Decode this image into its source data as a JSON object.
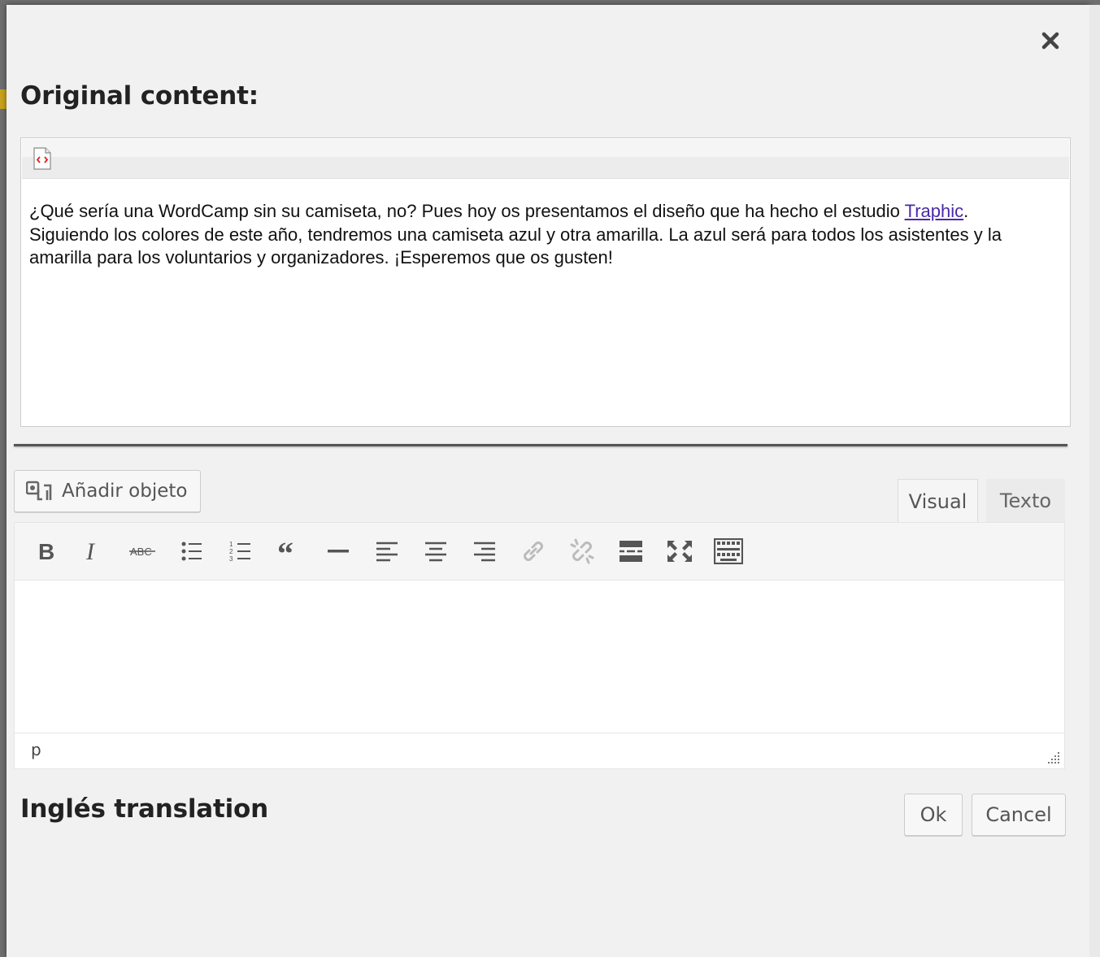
{
  "dialog": {
    "original_title": "Original content:",
    "original_text_before_link": "¿Qué sería una WordCamp sin su camiseta, no? Pues hoy os presentamos el diseño que ha hecho el estudio ",
    "original_link_text": "Traphic",
    "original_text_after_link": ". Siguiendo los colores de este año, tendremos una camiseta azul y otra amarilla. La azul será para todos los asistentes y la amarilla para los voluntarios y organizadores. ¡Esperemos que os gusten!",
    "translation_title": "Inglés translation"
  },
  "editor": {
    "add_media_label": "Añadir objeto",
    "tabs": {
      "visual": "Visual",
      "text": "Texto"
    },
    "status_path": "p",
    "toolbar": [
      "bold-icon",
      "italic-icon",
      "strikethrough-icon",
      "bulleted-list-icon",
      "numbered-list-icon",
      "blockquote-icon",
      "horizontal-line-icon",
      "align-left-icon",
      "align-center-icon",
      "align-right-icon",
      "link-icon",
      "unlink-icon",
      "read-more-icon",
      "fullscreen-icon",
      "toolbar-toggle-icon"
    ]
  },
  "buttons": {
    "ok": "Ok",
    "cancel": "Cancel"
  },
  "colors": {
    "modal_bg": "#f1f1f1",
    "link": "#4a2aa8",
    "icon": "#555555"
  }
}
